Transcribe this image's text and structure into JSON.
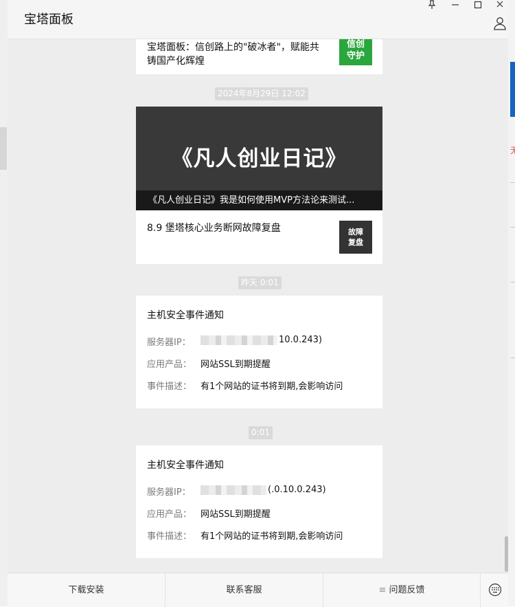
{
  "window": {
    "title": "宝塔面板"
  },
  "window_controls": {
    "pin": "⊥",
    "minimize": "—",
    "maximize": "□",
    "close": "✕"
  },
  "messages": {
    "card1": {
      "text": "宝塔面板：信创路上的\"破冰者\"，赋能共铸国产化辉煌",
      "thumb_text": "信创\n守护",
      "thumb_color": "#2aa63c"
    },
    "ts1": "2024年8月29日 12:02",
    "card2": {
      "banner_title": "《凡人创业日记》",
      "banner_caption": "《凡人创业日记》我是如何使用MVP方法论来测试...",
      "item_text": "8.9 堡塔核心业务断网故障复盘",
      "thumb_text": "故障\n复盘"
    },
    "ts2": "昨天 0:01",
    "notice1": {
      "title": "主机安全事件通知",
      "ip_label": "服务器IP：",
      "ip_value": "10.0.243)",
      "product_label": "应用产品：",
      "product_value": "网站SSL到期提醒",
      "desc_label": "事件描述：",
      "desc_value": "有1个网站的证书将到期,会影响访问"
    },
    "ts3": "0:01",
    "notice2": {
      "title": "主机安全事件通知",
      "ip_label": "服务器IP：",
      "ip_value": "(.0.10.0.243)",
      "product_label": "应用产品：",
      "product_value": "网站SSL到期提醒",
      "desc_label": "事件描述：",
      "desc_value": "有1个网站的证书将到期,会影响访问"
    }
  },
  "bottom_bar": {
    "download": "下载安装",
    "contact": "联系客服",
    "feedback": "问题反馈",
    "feedback_icon": "≡"
  },
  "background": {
    "accent_blue": "#1565c0",
    "red_glyph": "无"
  }
}
